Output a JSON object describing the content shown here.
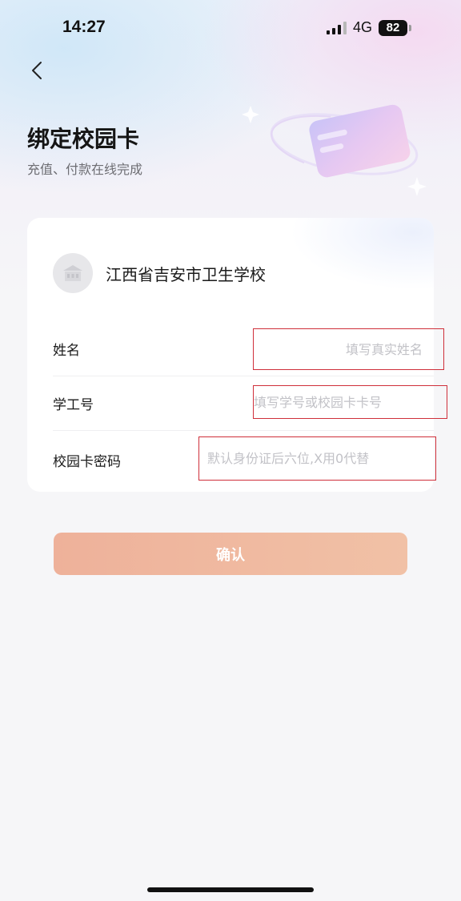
{
  "status_bar": {
    "time": "14:27",
    "network": "4G",
    "battery": "82"
  },
  "header": {
    "back_icon": "chevron-left-icon",
    "title": "绑定校园卡",
    "subtitle": "充值、付款在线完成"
  },
  "school": {
    "name": "江西省吉安市卫生学校",
    "logo_icon": "school-logo"
  },
  "form": {
    "fields": [
      {
        "label": "姓名",
        "placeholder": "填写真实姓名",
        "value": ""
      },
      {
        "label": "学工号",
        "placeholder": "填写学号或校园卡卡号",
        "value": ""
      },
      {
        "label": "校园卡密码",
        "placeholder": "默认身份证后六位,X用0代替",
        "value": ""
      }
    ]
  },
  "actions": {
    "confirm_label": "确认"
  },
  "colors": {
    "accent": "#efb59c",
    "highlight_border": "#cf2f3a",
    "background": "#f6f6f8"
  }
}
